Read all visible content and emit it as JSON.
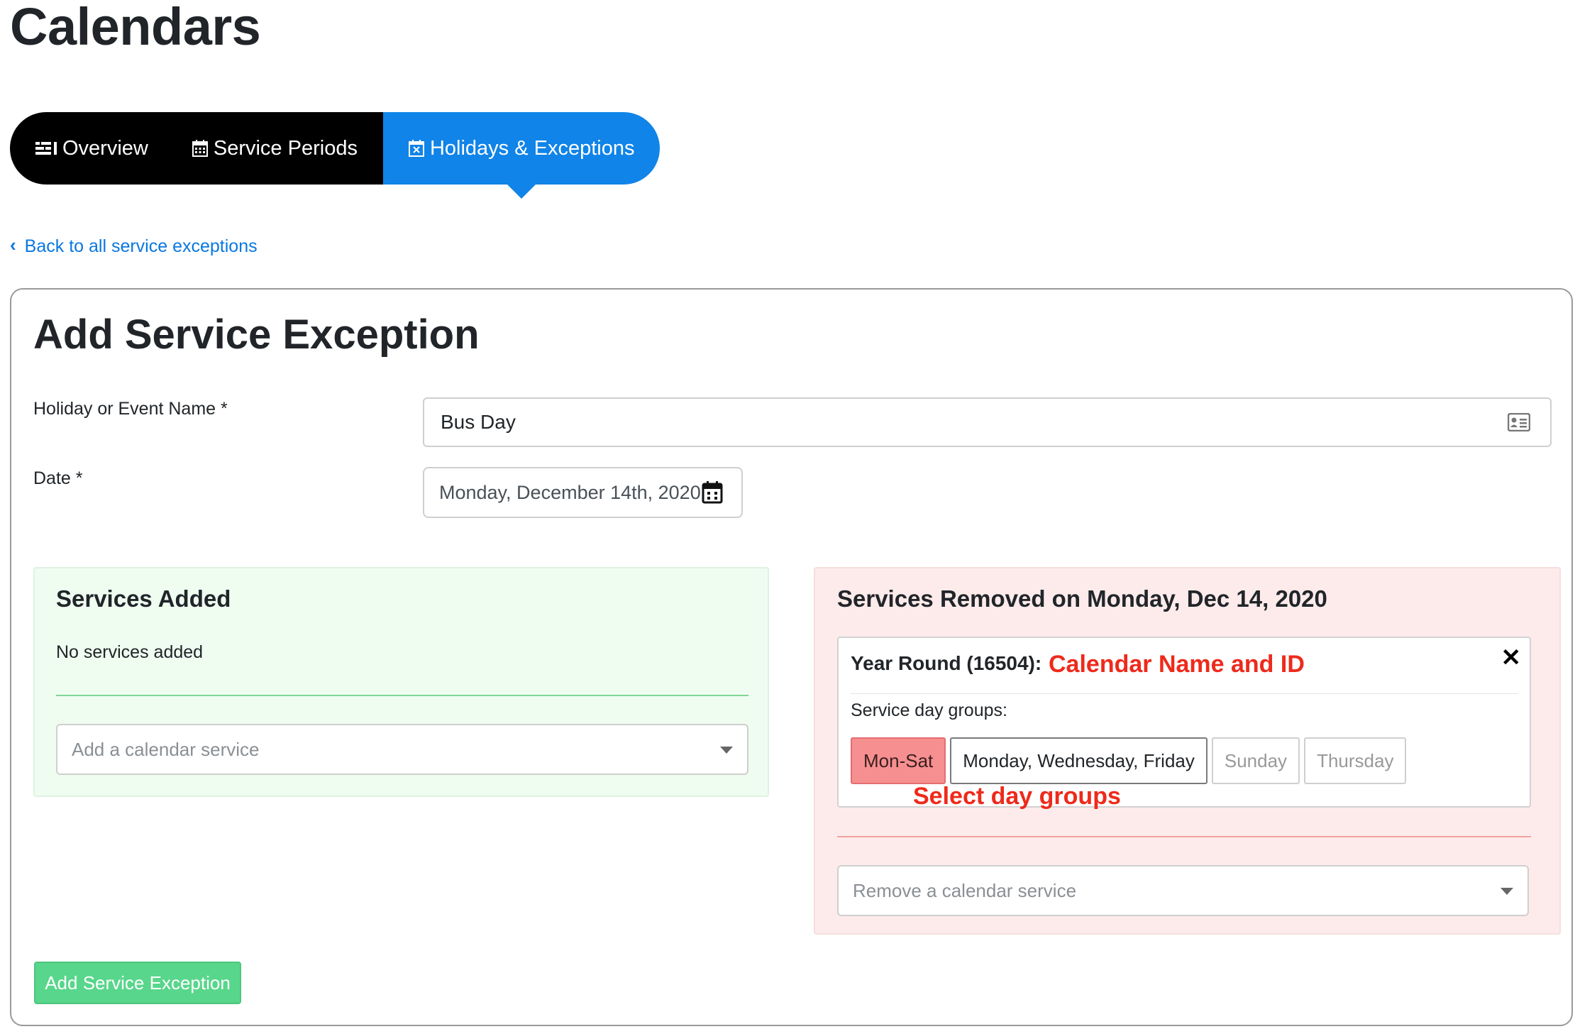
{
  "page": {
    "title": "Calendars"
  },
  "tabs": [
    {
      "label": "Overview",
      "icon": "list-icon",
      "active": false
    },
    {
      "label": "Service Periods",
      "icon": "calendar-icon",
      "active": false
    },
    {
      "label": "Holidays & Exceptions",
      "icon": "calendar-x-icon",
      "active": true
    }
  ],
  "back_link": {
    "label": "Back to all service exceptions"
  },
  "form": {
    "title": "Add Service Exception",
    "name_label": "Holiday or Event Name *",
    "name_value": "Bus Day",
    "date_label": "Date *",
    "date_value": "Monday, December 14th, 2020",
    "submit_label": "Add Service Exception"
  },
  "added": {
    "title": "Services Added",
    "empty_text": "No services added",
    "select_placeholder": "Add a calendar service"
  },
  "removed": {
    "title": "Services Removed on Monday, Dec 14, 2020",
    "service": {
      "name": "Year Round (16504):",
      "annotation": "Calendar Name and ID",
      "subtitle": "Service day groups:",
      "groups": [
        {
          "label": "Mon-Sat",
          "state": "selected-removed"
        },
        {
          "label": "Monday, Wednesday, Friday",
          "state": "available"
        },
        {
          "label": "Sunday",
          "state": "disabled"
        },
        {
          "label": "Thursday",
          "state": "disabled"
        }
      ],
      "groups_annotation": "Select day groups"
    },
    "select_placeholder": "Remove a calendar service"
  },
  "colors": {
    "tab_active": "#1084e8",
    "tab_inactive": "#000000",
    "link": "#0a78e0",
    "added_bg": "#effdf1",
    "removed_bg": "#fdebeb",
    "annotation": "#ee2a1b",
    "submit": "#58d68b"
  }
}
